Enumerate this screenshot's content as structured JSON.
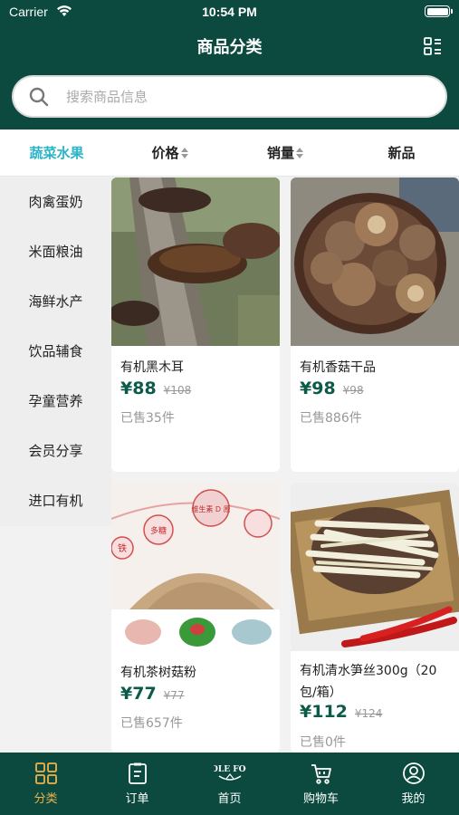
{
  "status_bar": {
    "carrier": "Carrier",
    "time": "10:54 PM"
  },
  "header": {
    "title": "商品分类"
  },
  "search": {
    "placeholder": "搜索商品信息",
    "value": ""
  },
  "filters": [
    {
      "label": "蔬菜水果",
      "active": true,
      "sortable": false
    },
    {
      "label": "价格",
      "active": false,
      "sortable": true
    },
    {
      "label": "销量",
      "active": false,
      "sortable": true
    },
    {
      "label": "新品",
      "active": false,
      "sortable": false
    }
  ],
  "categories": [
    "肉禽蛋奶",
    "米面粮油",
    "海鲜水产",
    "饮品辅食",
    "孕童营养",
    "会员分享",
    "进口有机"
  ],
  "products": [
    {
      "name": "有机黑木耳",
      "price": "¥88",
      "old_price": "¥108",
      "sold": "已售35件"
    },
    {
      "name": "有机香菇干品",
      "price": "¥98",
      "old_price": "¥98",
      "sold": "已售886件"
    },
    {
      "name": "有机茶树菇粉",
      "price": "¥77",
      "old_price": "¥77",
      "sold": "已售657件"
    },
    {
      "name": "有机清水笋丝300g（20包/箱）",
      "price": "¥112",
      "old_price": "¥124",
      "sold": "已售0件"
    }
  ],
  "image_text": {
    "bubble_1": "维生素 D 原",
    "bubble_2": "多糖",
    "bubble_3": "铁"
  },
  "tabbar": [
    {
      "label": "分类",
      "icon": "grid-icon",
      "active": true
    },
    {
      "label": "订单",
      "icon": "clipboard-icon",
      "active": false
    },
    {
      "label": "首页",
      "icon": "whole-foods-logo",
      "active": false
    },
    {
      "label": "购物车",
      "icon": "cart-icon",
      "active": false
    },
    {
      "label": "我的",
      "icon": "user-icon",
      "active": false
    }
  ],
  "logo_text": "WHOLE FOODS",
  "colors": {
    "primary": "#0c4a3f",
    "price": "#0c5a4a",
    "active_filter": "#2bb5c8",
    "active_tab": "#f0b24a"
  }
}
